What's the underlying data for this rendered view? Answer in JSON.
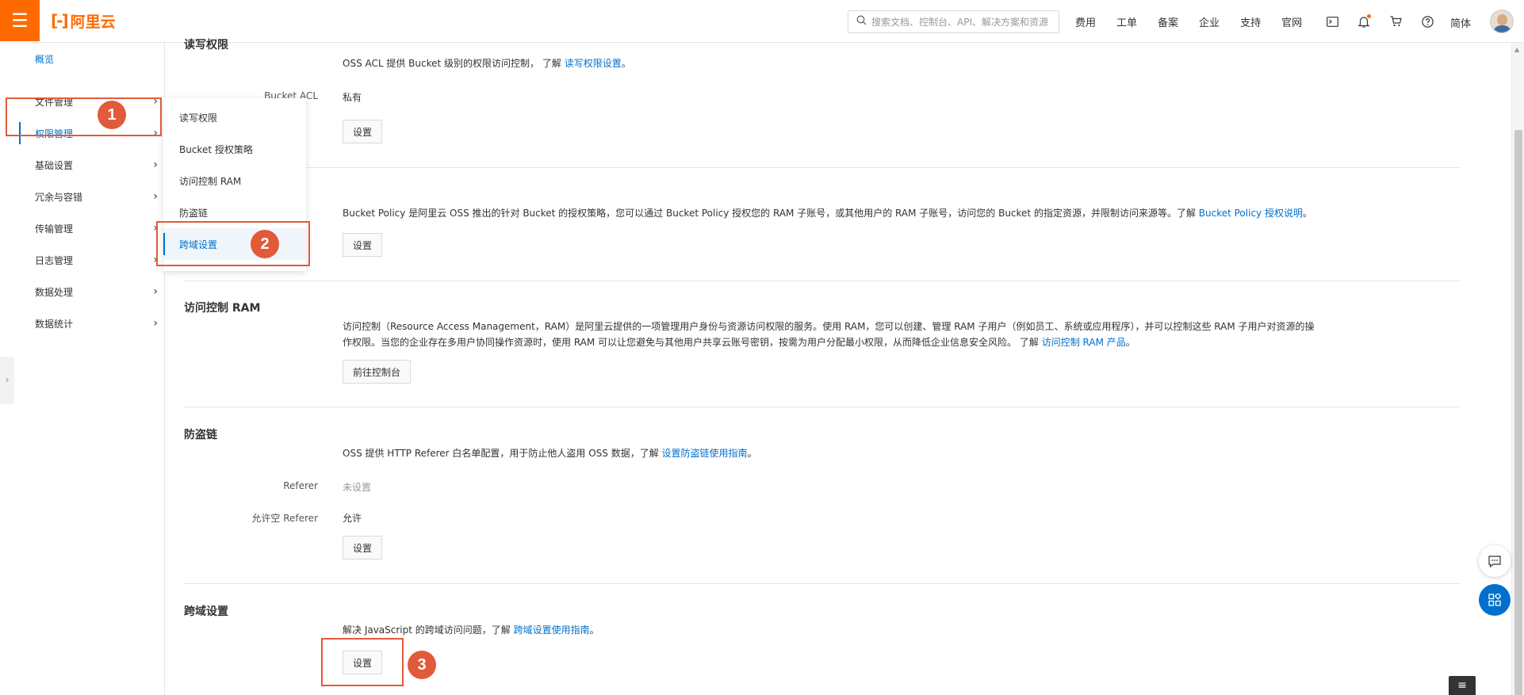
{
  "topbar": {
    "menu_icon": "☰",
    "logo_mark": "[-]",
    "logo_text": "阿里云",
    "search_placeholder": "搜索文档、控制台、API、解决方案和资源",
    "nav": [
      "费用",
      "工单",
      "备案",
      "企业",
      "支持",
      "官网"
    ],
    "lang": "简体"
  },
  "sidebar": {
    "overview": "概览",
    "items": [
      "文件管理",
      "权限管理",
      "基础设置",
      "冗余与容错",
      "传输管理",
      "日志管理",
      "数据处理",
      "数据统计"
    ]
  },
  "submenu": {
    "items": [
      "读写权限",
      "Bucket 授权策略",
      "访问控制 RAM",
      "防盗链",
      "跨域设置"
    ]
  },
  "badges": [
    "1",
    "2",
    "3"
  ],
  "sections": {
    "acl": {
      "title": "读写权限",
      "desc_prefix": "OSS ACL 提供 Bucket 级别的权限访问控制， 了解 ",
      "desc_link": "读写权限设置",
      "desc_suffix": "。",
      "field_label": "Bucket ACL",
      "field_value": "私有",
      "button": "设置"
    },
    "policy": {
      "desc_prefix": "Bucket Policy 是阿里云 OSS 推出的针对 Bucket 的授权策略，您可以通过 Bucket Policy 授权您的 RAM 子账号，或其他用户的 RAM 子账号，访问您的 Bucket 的指定资源，并限制访问来源等。了解 ",
      "desc_link": "Bucket Policy 授权说明",
      "desc_suffix": "。",
      "button": "设置"
    },
    "ram": {
      "title": "访问控制 RAM",
      "desc_line1": "访问控制（Resource Access Management，RAM）是阿里云提供的一项管理用户身份与资源访问权限的服务。使用 RAM，您可以创建、管理 RAM 子用户（例如员工、系统或应用程序），并可以控制这些 RAM 子用户对资源的操",
      "desc_line2_prefix": "作权限。当您的企业存在多用户协同操作资源时，使用 RAM 可以让您避免与其他用户共享云账号密钥，按需为用户分配最小权限，从而降低企业信息安全风险。 了解 ",
      "desc_link": "访问控制 RAM 产品",
      "desc_suffix": "。",
      "button": "前往控制台"
    },
    "referer": {
      "title": "防盗链",
      "desc_prefix": "OSS 提供 HTTP Referer 白名单配置，用于防止他人盗用 OSS 数据，了解 ",
      "desc_link": "设置防盗链使用指南",
      "desc_suffix": "。",
      "referer_label": "Referer",
      "referer_value": "未设置",
      "empty_label": "允许空 Referer",
      "empty_value": "允许",
      "button": "设置"
    },
    "cors": {
      "title": "跨域设置",
      "desc_prefix": "解决 JavaScript 的跨域访问问题，了解 ",
      "desc_link": "跨域设置使用指南",
      "desc_suffix": "。",
      "button": "设置"
    }
  },
  "colors": {
    "brand": "#ff6a00",
    "link": "#0070cc",
    "annotation": "#e15a3a"
  }
}
